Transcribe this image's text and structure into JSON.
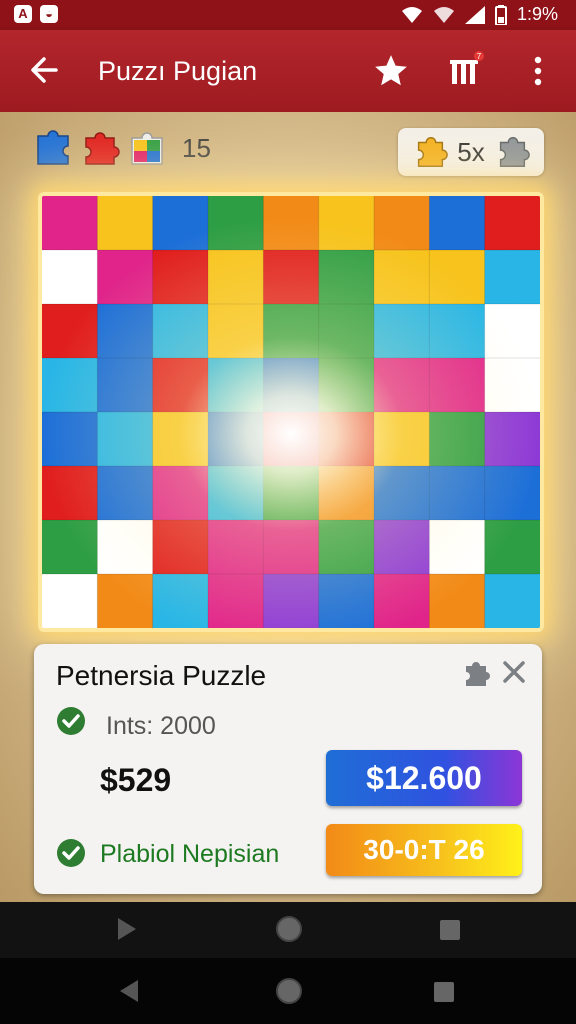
{
  "status_bar": {
    "time": "1:9%",
    "left_icons": [
      "notification-a-icon",
      "notification-b-icon"
    ],
    "right_icons": [
      "wifi-icon",
      "wifi-icon",
      "signal-icon",
      "battery-icon"
    ]
  },
  "app_bar": {
    "title": "Puzzı Pugian",
    "color": "#a81f25",
    "icons": [
      "back-arrow-icon",
      "star-icon",
      "stats-icon",
      "more-vert-icon"
    ],
    "stats_badge": "7"
  },
  "pieces": {
    "count": "15",
    "icons": [
      "blue-piece-icon",
      "red-piece-icon",
      "mixed-piece-icon"
    ]
  },
  "multiplier": {
    "label": "5x",
    "icons": [
      "gold-piece-icon",
      "gray-piece-icon"
    ]
  },
  "card": {
    "title": "Petnersia Puzzle",
    "ints": "Ints: 2000",
    "price": "$529",
    "buy_label": "$12.600",
    "green_label": "Plabiol Nepisian",
    "timer_label": "30-0:T 26",
    "icons": [
      "gear-piece-icon",
      "close-icon",
      "check-circle-icon"
    ]
  },
  "colors": {
    "accent": "#a81f25",
    "check": "#2e7d32",
    "buy_blue": "#2f52e0",
    "timer_orange": "#f5a31a"
  },
  "nav": {
    "row1": [
      "back-triangle-icon",
      "home-circle-icon",
      "recents-square-icon"
    ],
    "row2": [
      "back-triangle-icon",
      "home-circle-icon",
      "recents-square-icon"
    ]
  }
}
